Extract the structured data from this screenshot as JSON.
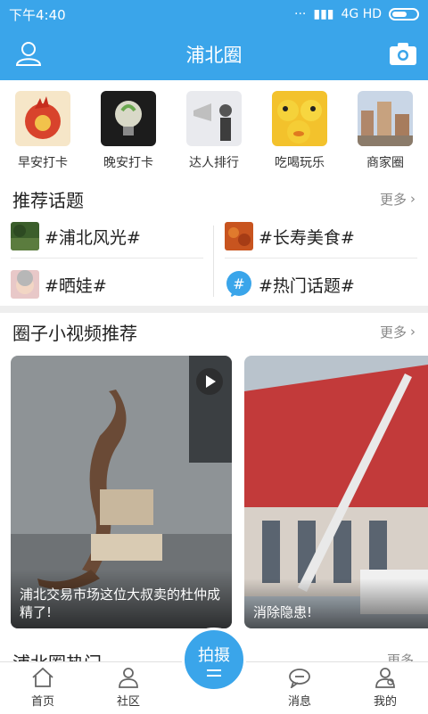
{
  "status_bar": {
    "time": "下午4:40",
    "network": "4G HD"
  },
  "header": {
    "title": "浦北圈"
  },
  "quick_entries": [
    {
      "label": "早安打卡",
      "icon": "rooster-icon"
    },
    {
      "label": "晚安打卡",
      "icon": "lightbulb-icon"
    },
    {
      "label": "达人排行",
      "icon": "megaphone-person-icon"
    },
    {
      "label": "吃喝玩乐",
      "icon": "ducks-icon"
    },
    {
      "label": "商家圈",
      "icon": "city-icon"
    }
  ],
  "topics_section": {
    "title": "推荐话题",
    "more": "更多",
    "items": [
      {
        "label": "#浦北风光#"
      },
      {
        "label": "#长寿美食#"
      },
      {
        "label": "#晒娃#"
      },
      {
        "label": "#热门话题#"
      }
    ]
  },
  "video_section": {
    "title": "圈子小视频推荐",
    "more": "更多",
    "videos": [
      {
        "caption": "浦北交易市场这位大叔卖的杜仲成精了!"
      },
      {
        "caption": "消除隐患!"
      }
    ]
  },
  "next_section": {
    "title": "浦北圈热门",
    "more": "更多"
  },
  "tabbar": {
    "items": [
      {
        "label": "首页"
      },
      {
        "label": "社区"
      },
      {
        "label": "消息"
      },
      {
        "label": "我的"
      }
    ],
    "shoot_label": "拍摄"
  },
  "colors": {
    "brand": "#3aa5ea"
  }
}
